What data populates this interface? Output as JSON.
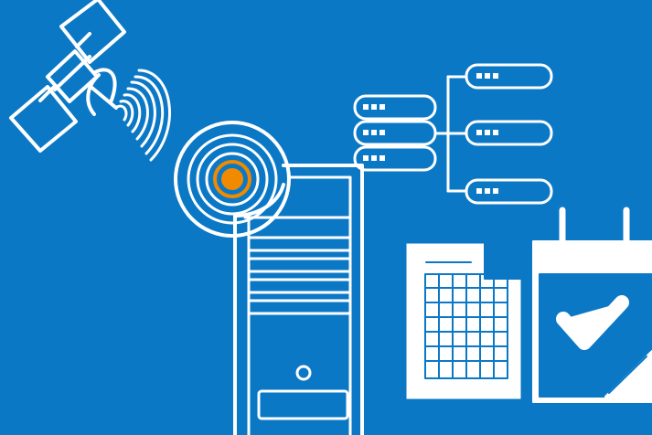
{
  "background_color": "#0b78c6",
  "line_color": "#ffffff",
  "accent_color": "#f28a00",
  "icons": [
    "satellite-icon",
    "signal-waves-icon",
    "target-icon",
    "server-tower-icon",
    "database-stack-icon",
    "network-tree-icon",
    "spreadsheet-document-icon",
    "calendar-check-icon"
  ]
}
